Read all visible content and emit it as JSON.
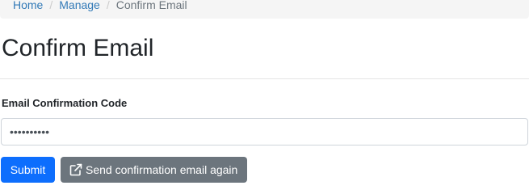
{
  "breadcrumb": {
    "items": [
      {
        "label": "Home"
      },
      {
        "label": "Manage"
      }
    ],
    "separator": "/",
    "active": "Confirm Email"
  },
  "page": {
    "title": "Confirm Email"
  },
  "form": {
    "code_label": "Email Confirmation Code",
    "code_value": "••••••••••",
    "submit_label": "Submit",
    "resend_label": "Send confirmation email again",
    "resend_icon": "external-link-icon"
  },
  "colors": {
    "link": "#337ab7",
    "primary": "#0d6efd",
    "secondary": "#6c757d",
    "breadcrumb_bg": "#f5f5f5"
  }
}
